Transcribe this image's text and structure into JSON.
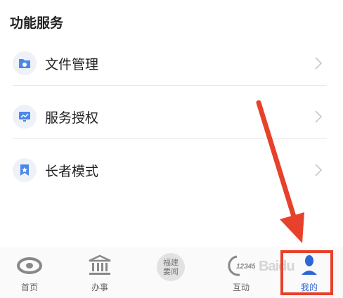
{
  "section": {
    "title": "功能服务"
  },
  "menu": [
    {
      "label": "文件管理",
      "icon": "folder-icon"
    },
    {
      "label": "服务授权",
      "icon": "monitor-chart-icon"
    },
    {
      "label": "长者模式",
      "icon": "bookmark-star-icon"
    }
  ],
  "tabs": [
    {
      "label": "首页",
      "icon": "home-logo-icon"
    },
    {
      "label": "办事",
      "icon": "bank-icon"
    },
    {
      "label": "福建\n要闻",
      "icon": "news-badge-icon",
      "badge_line1": "福建",
      "badge_line2": "要闻"
    },
    {
      "label": "互动",
      "icon": "hotline-12345-icon",
      "hotline": "12345"
    },
    {
      "label": "我的",
      "icon": "user-icon",
      "active": true
    }
  ],
  "colors": {
    "accent": "#2b67d8",
    "highlight": "#e8412b",
    "text": "#222222"
  },
  "watermark": "Baidu"
}
